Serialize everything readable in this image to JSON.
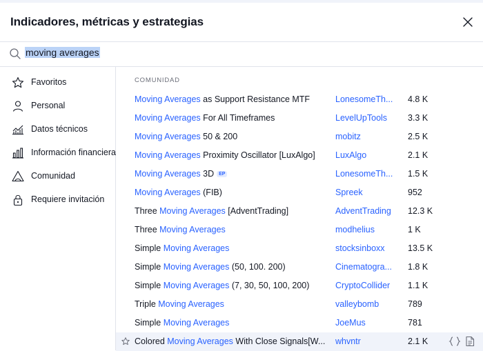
{
  "header": {
    "title": "Indicadores, métricas y estrategias",
    "close_icon": "close-icon"
  },
  "search": {
    "value": "moving averages",
    "icon": "search-icon"
  },
  "sidebar": {
    "items": [
      {
        "label": "Favoritos",
        "icon": "star-icon"
      },
      {
        "label": "Personal",
        "icon": "user-icon"
      },
      {
        "label": "Datos técnicos",
        "icon": "technical-chart-icon"
      },
      {
        "label": "Información financiera",
        "icon": "bar-chart-icon"
      },
      {
        "label": "Comunidad",
        "icon": "community-icon"
      },
      {
        "label": "Requiere invitación",
        "icon": "lock-icon"
      }
    ]
  },
  "main": {
    "section_label": "COMUNIDAD",
    "rows": [
      {
        "pre": "",
        "hl": "Moving Averages",
        "post": " as Support Resistance MTF",
        "badge": "",
        "author": "LonesomeTh...",
        "count": "4.8 K"
      },
      {
        "pre": "",
        "hl": "Moving Averages",
        "post": " For All Timeframes",
        "badge": "",
        "author": "LevelUpTools",
        "count": "3.3 K"
      },
      {
        "pre": "",
        "hl": "Moving Averages",
        "post": " 50 & 200",
        "badge": "",
        "author": "mobitz",
        "count": "2.5 K"
      },
      {
        "pre": "",
        "hl": "Moving Averages",
        "post": " Proximity Oscillator [LuxAlgo]",
        "badge": "",
        "author": "LuxAlgo",
        "count": "2.1 K"
      },
      {
        "pre": "",
        "hl": "Moving Averages",
        "post": " 3D",
        "badge": "EP",
        "author": "LonesomeTh...",
        "count": "1.5 K"
      },
      {
        "pre": "",
        "hl": "Moving Averages",
        "post": " (FIB)",
        "badge": "",
        "author": "Spreek",
        "count": "952"
      },
      {
        "pre": "Three ",
        "hl": "Moving Averages",
        "post": " [AdventTrading]",
        "badge": "",
        "author": "AdventTrading",
        "count": "12.3 K"
      },
      {
        "pre": "Three ",
        "hl": "Moving Averages",
        "post": "",
        "badge": "",
        "author": "modhelius",
        "count": "1 K"
      },
      {
        "pre": "Simple ",
        "hl": "Moving Averages",
        "post": "",
        "badge": "",
        "author": "stocksinboxx",
        "count": "13.5 K"
      },
      {
        "pre": "Simple ",
        "hl": "Moving Averages",
        "post": " (50, 100. 200)",
        "badge": "",
        "author": "Cinematogra...",
        "count": "1.8 K"
      },
      {
        "pre": "Simple ",
        "hl": "Moving Averages",
        "post": " (7, 30, 50, 100, 200)",
        "badge": "",
        "author": "CryptoCollider",
        "count": "1.1 K"
      },
      {
        "pre": "Triple ",
        "hl": "Moving Averages",
        "post": "",
        "badge": "",
        "author": "valleybomb",
        "count": "789"
      },
      {
        "pre": "Simple ",
        "hl": "Moving Averages",
        "post": "",
        "badge": "",
        "author": "JoeMus",
        "count": "781"
      },
      {
        "pre": "Colored ",
        "hl": "Moving Averages",
        "post": " With Close Signals[W...",
        "badge": "",
        "author": "whvntr",
        "count": "2.1 K",
        "selected": true
      }
    ]
  },
  "colors": {
    "accent": "#2962ff",
    "text": "#131722",
    "muted": "#6a6d78",
    "border": "#e0e3eb",
    "highlight": "#bbd3f7",
    "hover": "#f0f3fa"
  }
}
